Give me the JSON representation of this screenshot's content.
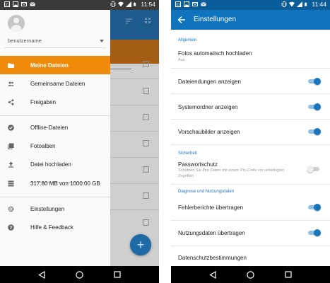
{
  "colors": {
    "accent_orange": "#f08a0a",
    "toolbar_blue": "#0f74bd",
    "statusbar_blue": "#0b5d99",
    "switch_on": "#1a75bd"
  },
  "left_screen": {
    "status_bar": {
      "time": "11:54",
      "icons": [
        "notification-icon",
        "image-icon",
        "mail-icon",
        "mail-icon",
        "vibrate-icon",
        "wifi-icon",
        "signal-icon",
        "battery-icon"
      ]
    },
    "drawer": {
      "account_name": "benutzername",
      "items": [
        {
          "label": "Meine Dateien",
          "icon": "folder-icon",
          "active": true
        },
        {
          "label": "Gemeinsame Dateien",
          "icon": "people-icon",
          "active": false
        },
        {
          "label": "Freigaben",
          "icon": "share-icon",
          "active": false
        },
        {
          "label": "Offline-Dateien",
          "icon": "offline-pin-icon",
          "active": false
        },
        {
          "label": "Fotoalben",
          "icon": "photo-albums-icon",
          "active": false
        },
        {
          "label": "Datei hochladen",
          "icon": "upload-icon",
          "active": false
        },
        {
          "label": "317.80 MB von 1000.00 GB",
          "icon": "storage-icon",
          "active": false
        },
        {
          "label": "Einstellungen",
          "icon": "gear-icon",
          "active": false
        },
        {
          "label": "Hilfe & Feedback",
          "icon": "help-icon",
          "active": false
        }
      ],
      "quota_fraction": 0.0003
    },
    "fab_label": "+"
  },
  "right_screen": {
    "status_bar": {
      "time": "11:44",
      "icons": [
        "notification-icon",
        "image-icon",
        "mail-icon",
        "mail-icon",
        "vibrate-icon",
        "wifi-icon",
        "signal-icon",
        "battery-icon"
      ]
    },
    "title": "Einstellungen",
    "sections": [
      {
        "header": "Allgemein",
        "prefs": [
          {
            "title": "Fotos automatisch hochladen",
            "summary": "Aus",
            "switch": null
          },
          {
            "title": "Dateiendungen anzeigen",
            "summary": "",
            "switch": true
          },
          {
            "title": "Systemordner anzeigen",
            "summary": "",
            "switch": true
          },
          {
            "title": "Vorschaubilder anzeigen",
            "summary": "",
            "switch": true
          }
        ]
      },
      {
        "header": "Sicherheit",
        "prefs": [
          {
            "title": "Passwortschutz",
            "summary": "Schützen Sie Ihre Daten mit einem Pin-Code vor unbefugten",
            "summary2": "Zugriffen",
            "switch": false
          }
        ]
      },
      {
        "header": "Diagnose und Nutzungsdaten",
        "prefs": [
          {
            "title": "Fehlerberichte übertragen",
            "summary": "",
            "switch": true
          },
          {
            "title": "Nutzungsdaten übertragen",
            "summary": "",
            "switch": true
          },
          {
            "title": "Datenschutzbestimmungen",
            "summary": "",
            "switch": null
          }
        ]
      }
    ]
  }
}
